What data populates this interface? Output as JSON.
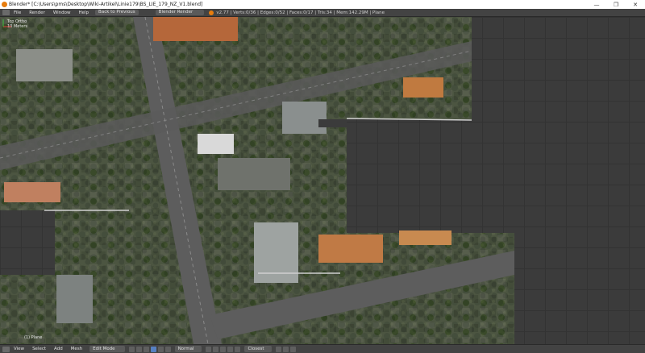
{
  "window": {
    "title": "Blender* [C:\\Users\\pms\\Desktop\\Wiki-Artikel\\Linie179\\BS_LIE_179_NZ_V1.blend]",
    "minimize": "—",
    "maximize": "❐",
    "close": "✕"
  },
  "menubar": {
    "items": [
      "File",
      "Render",
      "Window",
      "Help"
    ],
    "back_button": "Back to Previous",
    "render_engine": "Blender Render",
    "stats": "v2.77 | Verts:0/36 | Edges:0/52 | Faces:0/17 | Tris:34 | Mem:142.29M | Plane"
  },
  "viewport": {
    "view_name": "Top Ortho",
    "units": "10 Meters",
    "object_label": "(1) Plane"
  },
  "bottombar": {
    "items": [
      "View",
      "Select",
      "Add",
      "Mesh"
    ],
    "mode": "Edit Mode",
    "pivot": "Normal",
    "proportional": "Closest"
  },
  "colors": {
    "accent": "#e87d0d",
    "ui_bg": "#434343",
    "viewport_bg": "#3b3b3b"
  }
}
